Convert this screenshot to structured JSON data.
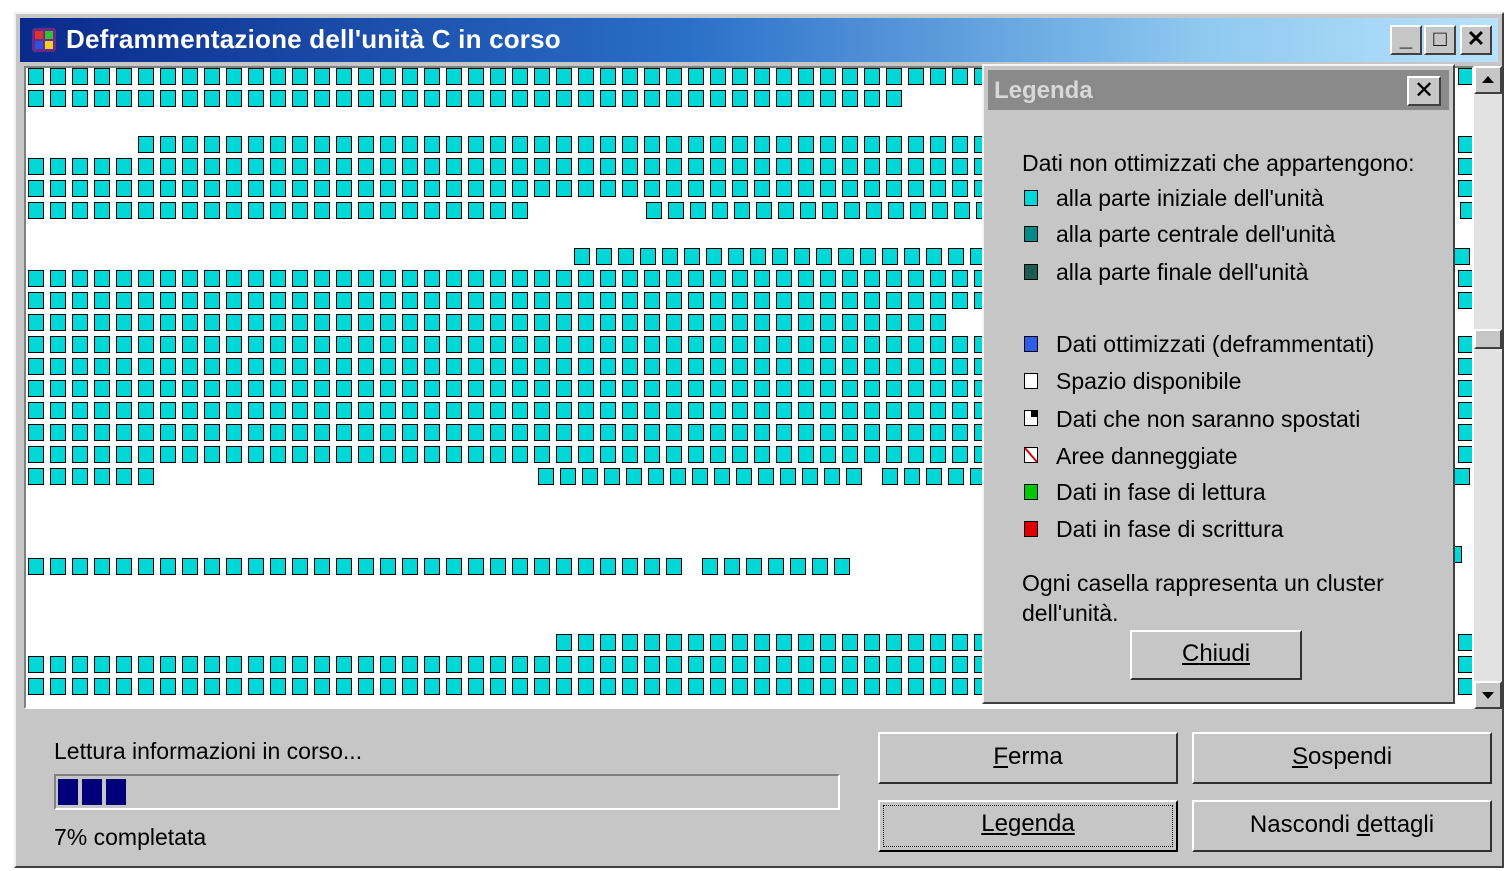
{
  "window": {
    "title": "Deframmentazione dell'unità C  in corso",
    "controls": {
      "minimize": "_",
      "maximize": "□",
      "close": "✕"
    }
  },
  "legend": {
    "title": "Legenda",
    "close_glyph": "✕",
    "heading": "Dati non ottimizzati che appartengono:",
    "items": [
      {
        "label": "alla parte iniziale dell'unità",
        "color": "#00d8d8"
      },
      {
        "label": "alla parte centrale dell'unità",
        "color": "#008a8a"
      },
      {
        "label": "alla parte finale dell'unità",
        "color": "#1c5c50"
      },
      {
        "label": "Dati ottimizzati (deframmentati)",
        "color": "#2c5ce8"
      },
      {
        "label": "Spazio disponibile",
        "color": "#ffffff"
      },
      {
        "label": "Dati che non saranno spostati",
        "color": "#ffffff"
      },
      {
        "label": "Aree danneggiate",
        "color": "#ffffff"
      },
      {
        "label": "Dati in fase di lettura",
        "color": "#00c800"
      },
      {
        "label": "Dati in fase di scrittura",
        "color": "#e00000"
      }
    ],
    "note_line1": "Ogni casella rappresenta un cluster",
    "note_line2": "dell'unità.",
    "close_button": {
      "mnemonic": "C",
      "rest": "hiudi"
    }
  },
  "status": {
    "message": "Lettura informazioni in corso...",
    "progress_percent": 7,
    "completed_label": "7% completata"
  },
  "buttons": {
    "stop": {
      "mnemonic": "F",
      "rest": "erma"
    },
    "pause": {
      "mnemonic": "S",
      "rest": "ospendi"
    },
    "legend": {
      "mnemonic": "L",
      "rest": "egenda"
    },
    "hide_details": {
      "pre": "Nascondi ",
      "mnemonic": "d",
      "rest": "ettagli"
    }
  }
}
